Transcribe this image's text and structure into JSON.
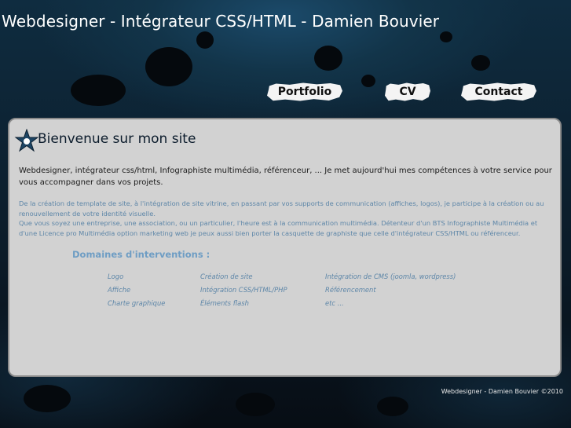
{
  "header": {
    "title": "Webdesigner - Intégrateur CSS/HTML - Damien Bouvier"
  },
  "nav": {
    "portfolio": "Portfolio",
    "cv": "CV",
    "contact": "Contact"
  },
  "main": {
    "heading": "Bienvenue sur mon site",
    "intro": "Webdesigner, intégrateur css/html, Infographiste multimédia, référenceur, ... Je met aujourd'hui mes compétences à votre service pour vous accompagner dans vos projets.",
    "paragraph1": "De la création de template de site, à l'intégration de site vitrine, en passant par vos supports de communication (affiches, logos), je participe à la création ou au renouvellement de votre identité visuelle.",
    "paragraph2": "Que vous soyez une entreprise, une association, ou un particulier, l'heure est à la communication multimédia. Détenteur d'un BTS Infographiste Multimédia et d'une Licence pro Multimédia option marketing web je peux aussi bien porter la casquette de graphiste que celle d'intégrateur CSS/HTML ou référenceur.",
    "domains_title": "Domaines d'interventions :",
    "services": [
      [
        "Logo",
        "Création de site",
        "Intégration de CMS (joomla, wordpress)"
      ],
      [
        "Affiche",
        "Intégration CSS/HTML/PHP",
        "Référencement"
      ],
      [
        "Charte graphique",
        "Éléments flash",
        "etc ..."
      ]
    ]
  },
  "footer": {
    "text": "Webdesigner - Damien Bouvier ©2010"
  },
  "colors": {
    "panel": "#d2d2d2",
    "accent_blue": "#5d86a8",
    "header_bg": "#123449"
  }
}
